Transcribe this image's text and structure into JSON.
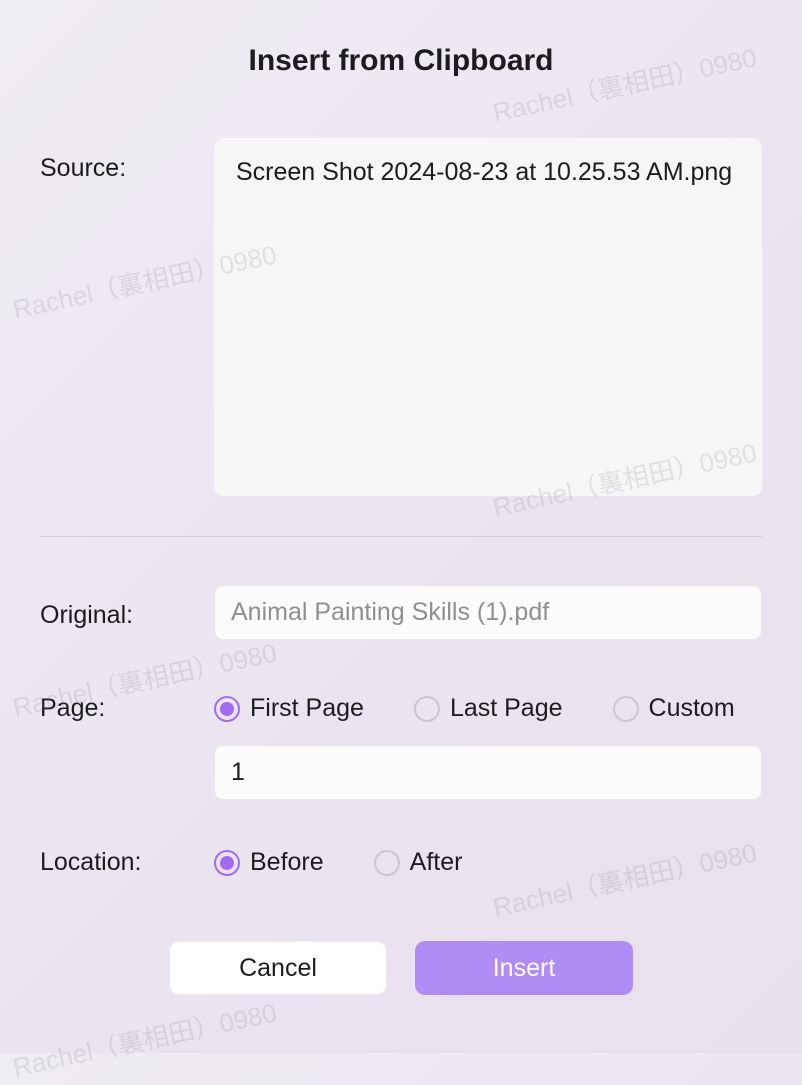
{
  "title": "Insert from Clipboard",
  "labels": {
    "source": "Source:",
    "original": "Original:",
    "page": "Page:",
    "location": "Location:"
  },
  "source_filename": "Screen Shot 2024-08-23 at 10.25.53 AM.png",
  "original_filename": "Animal Painting Skills (1).pdf",
  "page_options": {
    "first": "First Page",
    "last": "Last Page",
    "custom": "Custom"
  },
  "page_number": "1",
  "location_options": {
    "before": "Before",
    "after": "After"
  },
  "buttons": {
    "cancel": "Cancel",
    "insert": "Insert"
  },
  "watermark_text": "Rachel（裏相田）0980",
  "colors": {
    "accent": "#a36cf0",
    "button_primary": "#b18cf5"
  }
}
